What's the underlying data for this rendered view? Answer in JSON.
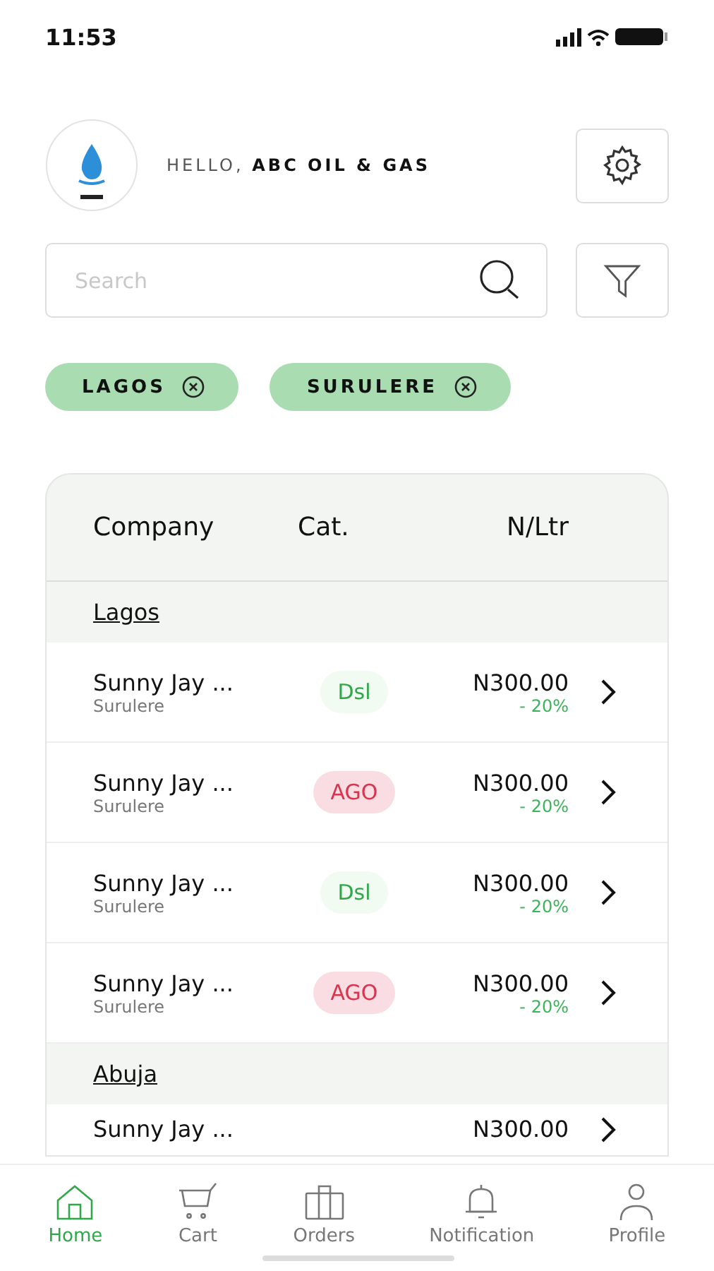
{
  "status_bar": {
    "time": "11:53"
  },
  "header": {
    "greeting": "HELLO,",
    "company": "ABC OIL & GAS"
  },
  "search": {
    "placeholder": "Search"
  },
  "chips": [
    {
      "label": "LAGOS"
    },
    {
      "label": "SURULERE"
    }
  ],
  "table": {
    "columns": [
      "Company",
      "Cat.",
      "N/Ltr"
    ],
    "groups": [
      {
        "name": "Lagos",
        "rows": [
          {
            "company": "Sunny Jay ...",
            "area": "Surulere",
            "category": {
              "label": "Dsl",
              "kind": "dsl"
            },
            "price": "N300.00",
            "discount": "- 20%"
          },
          {
            "company": "Sunny Jay ...",
            "area": "Surulere",
            "category": {
              "label": "AGO",
              "kind": "ago"
            },
            "price": "N300.00",
            "discount": "- 20%"
          },
          {
            "company": "Sunny Jay ...",
            "area": "Surulere",
            "category": {
              "label": "Dsl",
              "kind": "dsl"
            },
            "price": "N300.00",
            "discount": "- 20%"
          },
          {
            "company": "Sunny Jay ...",
            "area": "Surulere",
            "category": {
              "label": "AGO",
              "kind": "ago"
            },
            "price": "N300.00",
            "discount": "- 20%"
          }
        ]
      },
      {
        "name": "Abuja",
        "rows": [
          {
            "company": "Sunny Jay ...",
            "price": "N300.00"
          }
        ]
      }
    ]
  },
  "bottom_nav": [
    {
      "label": "Home",
      "selected": true
    },
    {
      "label": "Cart",
      "selected": false
    },
    {
      "label": "Orders",
      "selected": false
    },
    {
      "label": "Notification",
      "selected": false
    },
    {
      "label": "Profile",
      "selected": false
    }
  ]
}
